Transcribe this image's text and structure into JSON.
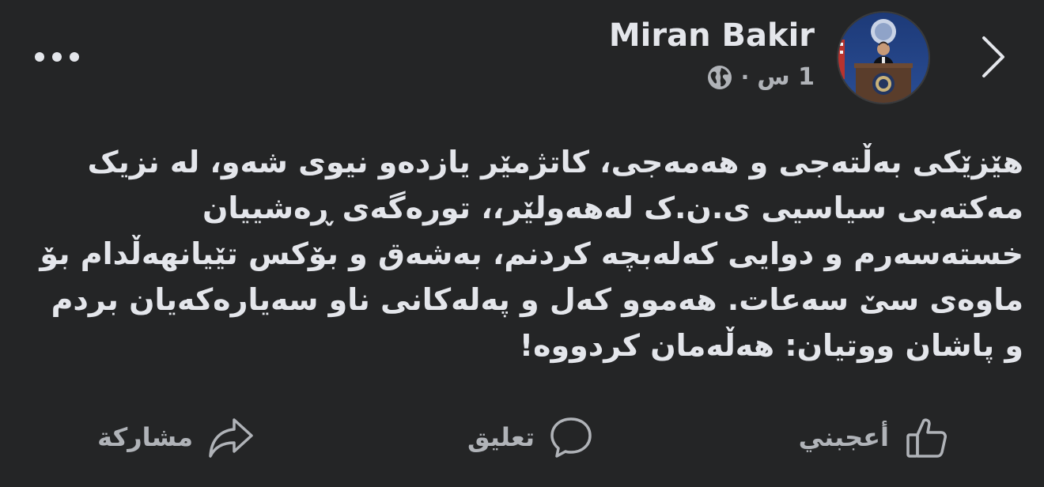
{
  "header": {
    "author_name": "Miran Bakir",
    "time_label": "1 س",
    "separator": "·",
    "privacy_icon": "globe-icon",
    "more_icon": "more-dots-icon",
    "back_icon": "chevron-right-icon"
  },
  "post": {
    "text": "هێزێکی بەڵتەجی و هەمەجی، کاتژمێر یازدەو نیوی شەو، لە نزیک مەکتەبی سیاسیی ی.ن.ک لەهەولێر،، تورەگەی ڕەشییان خستەسەرم و دوایی کەلەبچە کردنم، بەشەق و بۆکس تێیانهەڵدام بۆ ماوەی سێ سەعات. هەموو کەل و پەلەکانی ناو سەیارەکەیان بردم و پاشان ووتیان: هەڵەمان کردووە!"
  },
  "actions": {
    "like_label": "أعجبني",
    "like_icon": "thumbs-up-icon",
    "comment_label": "تعليق",
    "comment_icon": "comment-bubble-icon",
    "share_label": "مشاركة",
    "share_icon": "share-arrow-icon"
  },
  "colors": {
    "background": "#242526",
    "primary_text": "#e4e6eb",
    "secondary_text": "#b0b3b8"
  }
}
